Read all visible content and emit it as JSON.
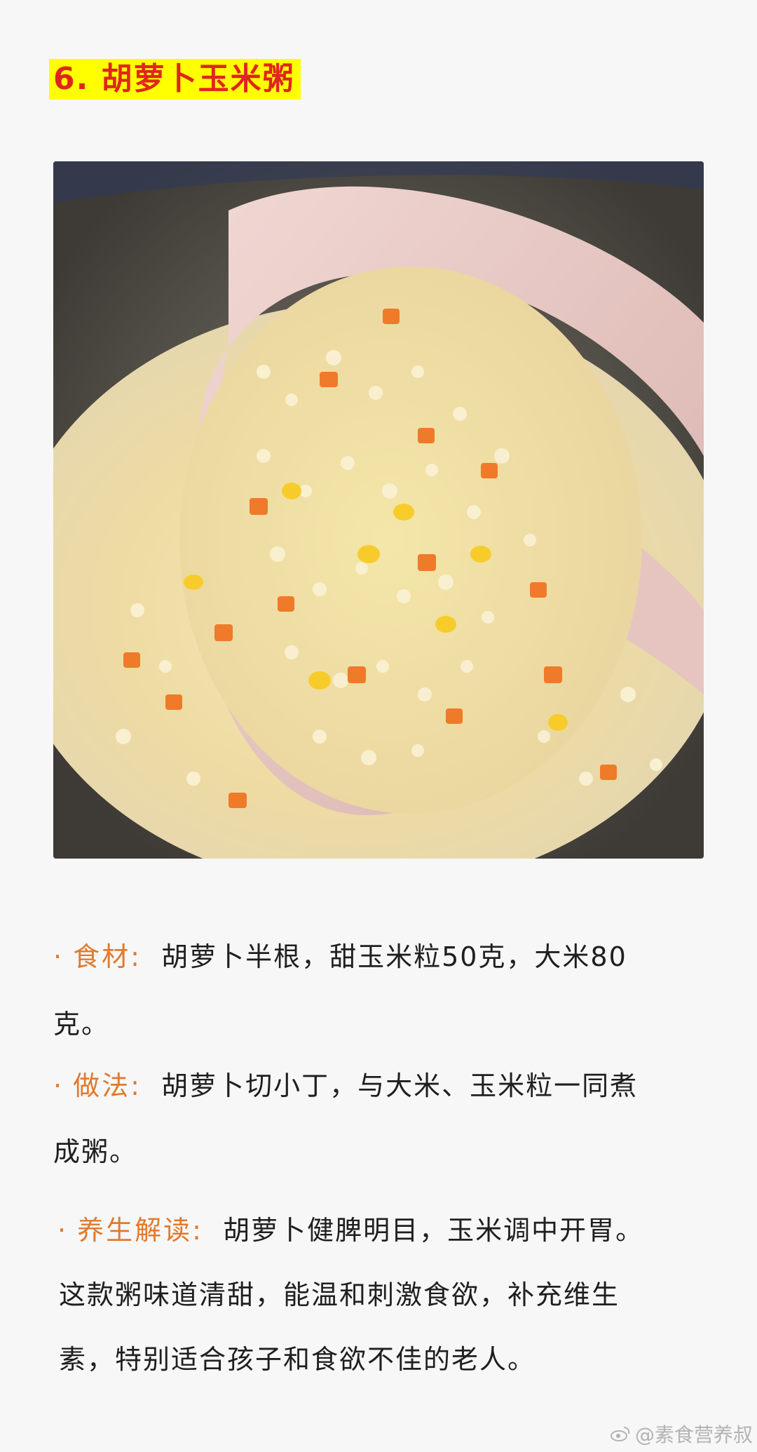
{
  "title": "6. 胡萝卜玉米粥",
  "photo": {
    "icon": "carrot-corn-porridge-photo"
  },
  "sections": {
    "ingredients": {
      "label": "食材:",
      "text_line1": "胡萝卜半根，甜玉米粒50克，大米80",
      "text_line2": "克。"
    },
    "method": {
      "label": "做法:",
      "text_line1": "胡萝卜切小丁，与大米、玉米粒一同煮",
      "text_line2": "成粥。"
    },
    "health": {
      "label": "养生解读:",
      "text_line1": "胡萝卜健脾明目，玉米调中开胃。",
      "text_line2": "这款粥味道清甜，能温和刺激食欲，补充维生",
      "text_line3": "素，特别适合孩子和食欲不佳的老人。"
    }
  },
  "bullet": "·",
  "watermark": {
    "text": "@素食营养叔",
    "icon": "weibo-icon"
  },
  "colors": {
    "title_bg": "#ffff00",
    "title_text": "#e0261c",
    "label": "#e07a2e"
  }
}
